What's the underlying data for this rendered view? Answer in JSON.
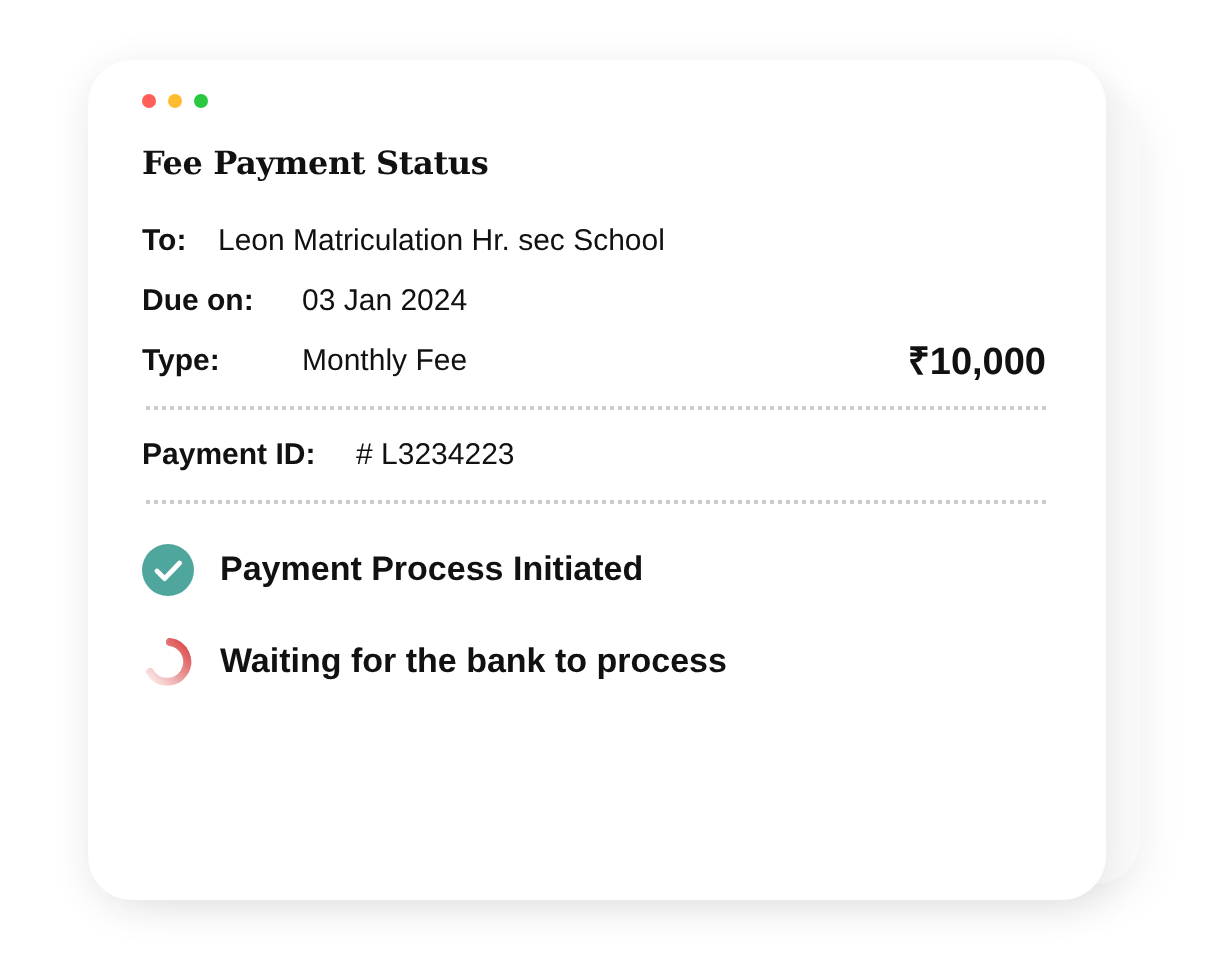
{
  "title": "Fee Payment Status",
  "details": [
    {
      "label": "To:",
      "value": "Leon Matriculation Hr. sec School"
    },
    {
      "label": "Due on:",
      "value": "03 Jan 2024"
    },
    {
      "label": "Type:",
      "value": "Monthly Fee",
      "amount": "₹10,000"
    }
  ],
  "payment_id": {
    "label": "Payment ID:",
    "value": "# L3234223"
  },
  "steps": [
    {
      "kind": "done",
      "text": "Payment Process Initiated"
    },
    {
      "kind": "pending",
      "text": "Waiting for the bank to process"
    }
  ]
}
